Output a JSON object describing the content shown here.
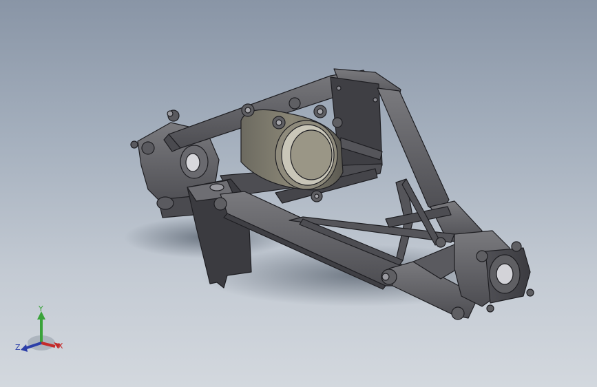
{
  "viewport": {
    "background_top": "#8995a6",
    "background_bottom": "#d3d8de",
    "part_color": "#5f5f63",
    "part_edge_color": "#1e1e22"
  },
  "triad": {
    "x_label": "X",
    "y_label": "Y",
    "z_label": "Z",
    "x_color": "#c42a2a",
    "y_color": "#3aa33a",
    "z_color": "#2b3ea8"
  }
}
